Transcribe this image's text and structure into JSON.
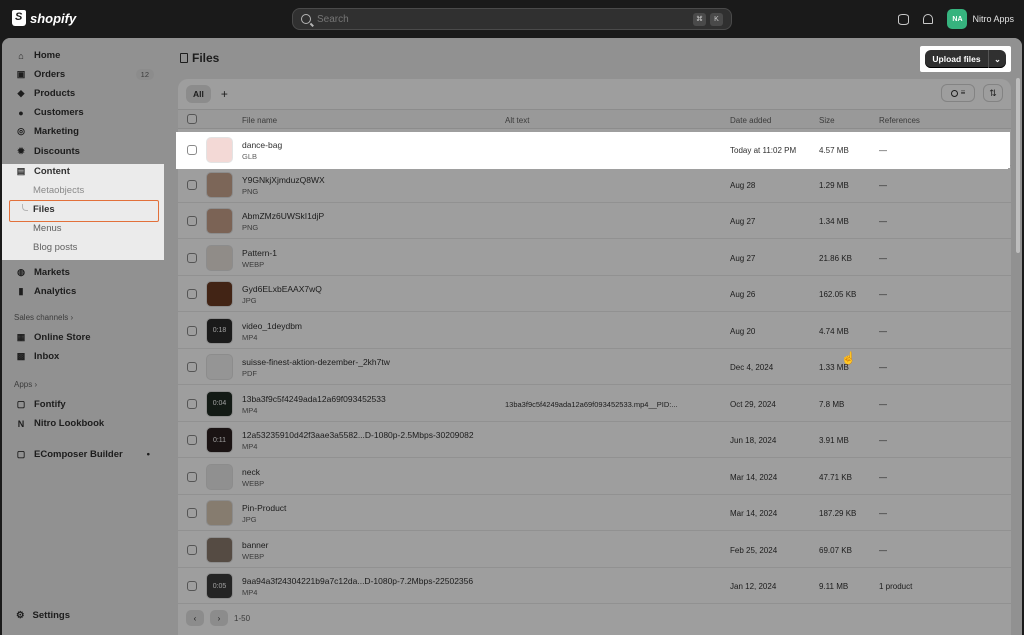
{
  "topbar": {
    "brand": "shopify",
    "search_placeholder": "Search",
    "kbd1": "⌘",
    "kbd2": "K",
    "avatar_initials": "NA",
    "store_name": "Nitro Apps"
  },
  "sidebar": {
    "items": [
      {
        "label": "Home",
        "icon": "home-icon"
      },
      {
        "label": "Orders",
        "icon": "orders-icon",
        "badge": "12"
      },
      {
        "label": "Products",
        "icon": "tag-icon"
      },
      {
        "label": "Customers",
        "icon": "person-icon"
      },
      {
        "label": "Marketing",
        "icon": "target-icon"
      },
      {
        "label": "Discounts",
        "icon": "discount-icon"
      }
    ],
    "content": {
      "label": "Content",
      "sub": [
        "Metaobjects",
        "Files",
        "Menus",
        "Blog posts"
      ]
    },
    "items2": [
      {
        "label": "Markets",
        "icon": "globe-icon"
      },
      {
        "label": "Analytics",
        "icon": "chart-icon"
      }
    ],
    "sales_channels_label": "Sales channels ›",
    "channels": [
      "Online Store",
      "Inbox"
    ],
    "apps_label": "Apps ›",
    "apps": [
      "Fontify",
      "Nitro Lookbook",
      "EComposer Builder"
    ],
    "settings": "Settings"
  },
  "page": {
    "title": "Files",
    "upload_label": "Upload files",
    "tab_all": "All",
    "tab_add": "+",
    "columns": [
      "File name",
      "Alt text",
      "Date added",
      "Size",
      "References"
    ],
    "rows": [
      {
        "name": "dance-bag",
        "type": "GLB",
        "alt": "",
        "date": "Today at 11:02 PM",
        "size": "4.57 MB",
        "refs": "—",
        "thumb": "#f3d9d6"
      },
      {
        "name": "Y9GNkjXjmduzQ8WX",
        "type": "PNG",
        "alt": "",
        "date": "Aug 28",
        "size": "1.29 MB",
        "refs": "—",
        "thumb": "#c9a58f"
      },
      {
        "name": "AbmZMz6UWSkI1djP",
        "type": "PNG",
        "alt": "",
        "date": "Aug 27",
        "size": "1.34 MB",
        "refs": "—",
        "thumb": "#c7a08a"
      },
      {
        "name": "Pattern-1",
        "type": "WEBP",
        "alt": "",
        "date": "Aug 27",
        "size": "21.86 KB",
        "refs": "—",
        "thumb": "#e8e2dc"
      },
      {
        "name": "Gyd6ELxbEAAX7wQ",
        "type": "JPG",
        "alt": "",
        "date": "Aug 26",
        "size": "162.05 KB",
        "refs": "—",
        "thumb": "#6b3a22"
      },
      {
        "name": "video_1deydbm",
        "type": "MP4",
        "alt": "",
        "date": "Aug 20",
        "size": "4.74 MB",
        "refs": "—",
        "thumb": "#2a2a2a",
        "overlay": "0:18"
      },
      {
        "name": "suisse-finest-aktion-dezember-_2kh7tw",
        "type": "PDF",
        "alt": "",
        "date": "Dec 4, 2024",
        "size": "1.33 MB",
        "refs": "—",
        "thumb": "#f1f1f1"
      },
      {
        "name": "13ba3f9c5f4249ada12a69f093452533",
        "type": "MP4",
        "alt": "13ba3f9c5f4249ada12a69f093452533.mp4__PID:...",
        "date": "Oct 29, 2024",
        "size": "7.8 MB",
        "refs": "—",
        "thumb": "#1f2a22",
        "overlay": "0:04"
      },
      {
        "name": "12a53235910d42f3aae3a5582...D-1080p-2.5Mbps-30209082",
        "type": "MP4",
        "alt": "",
        "date": "Jun 18, 2024",
        "size": "3.91 MB",
        "refs": "—",
        "thumb": "#2b2020",
        "overlay": "0:11"
      },
      {
        "name": "neck",
        "type": "WEBP",
        "alt": "",
        "date": "Mar 14, 2024",
        "size": "47.71 KB",
        "refs": "—",
        "thumb": "#e9e9e9"
      },
      {
        "name": "Pin-Product",
        "type": "JPG",
        "alt": "",
        "date": "Mar 14, 2024",
        "size": "187.29 KB",
        "refs": "—",
        "thumb": "#d8c8b4"
      },
      {
        "name": "banner",
        "type": "WEBP",
        "alt": "",
        "date": "Feb 25, 2024",
        "size": "69.07 KB",
        "refs": "—",
        "thumb": "#8a7a6c"
      },
      {
        "name": "9aa94a3f24304221b9a7c12da...D-1080p-7.2Mbps-22502356",
        "type": "MP4",
        "alt": "",
        "date": "Jan 12, 2024",
        "size": "9.11 MB",
        "refs": "1 product",
        "thumb": "#3a3a3a",
        "overlay": "0:05"
      }
    ],
    "pagination": "1-50",
    "prev": "‹",
    "next": "›"
  }
}
